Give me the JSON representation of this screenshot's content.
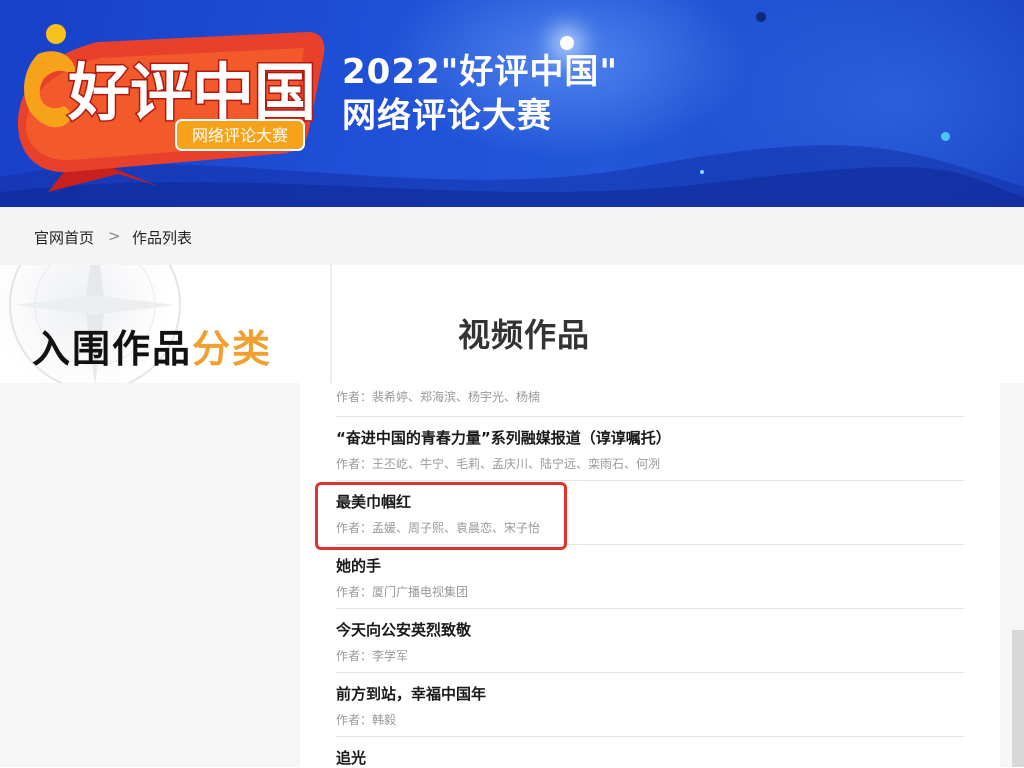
{
  "banner": {
    "logo_main": "好评中国",
    "logo_sub": "网络评论大赛",
    "title_line1": "2022\"好评中国\"",
    "title_line2": "网络评论大赛"
  },
  "breadcrumb": {
    "home": "官网首页",
    "separator": ">",
    "current": "作品列表"
  },
  "category": {
    "title_main": "入围作品",
    "title_highlight": "分类",
    "highlight_color": "#f0a030"
  },
  "section": {
    "title": "视频作品"
  },
  "works": [
    {
      "title": "",
      "authors": "作者：裴希婷、郑海滨、杨宇光、杨楠"
    },
    {
      "title": "“奋进中国的青春力量”系列融媒报道（谆谆嘱托）",
      "authors": "作者：王丕屹、牛宁、毛莉、孟庆川、陆宁远、栾雨石、何冽"
    },
    {
      "title": "最美巾帼红",
      "authors": "作者：孟媛、周子熙、袁晨恋、宋子怡"
    },
    {
      "title": "她的手",
      "authors": "作者：厦门广播电视集团"
    },
    {
      "title": "今天向公安英烈致敬",
      "authors": "作者：李学军"
    },
    {
      "title": "前方到站，幸福中国年",
      "authors": "作者：韩毅"
    },
    {
      "title": "追光",
      "authors": ""
    }
  ],
  "colors": {
    "banner_blue": "#1f4fd6",
    "highlight_border": "#e0322c",
    "logo_red": "#e8402a",
    "logo_orange": "#f7a21b"
  }
}
